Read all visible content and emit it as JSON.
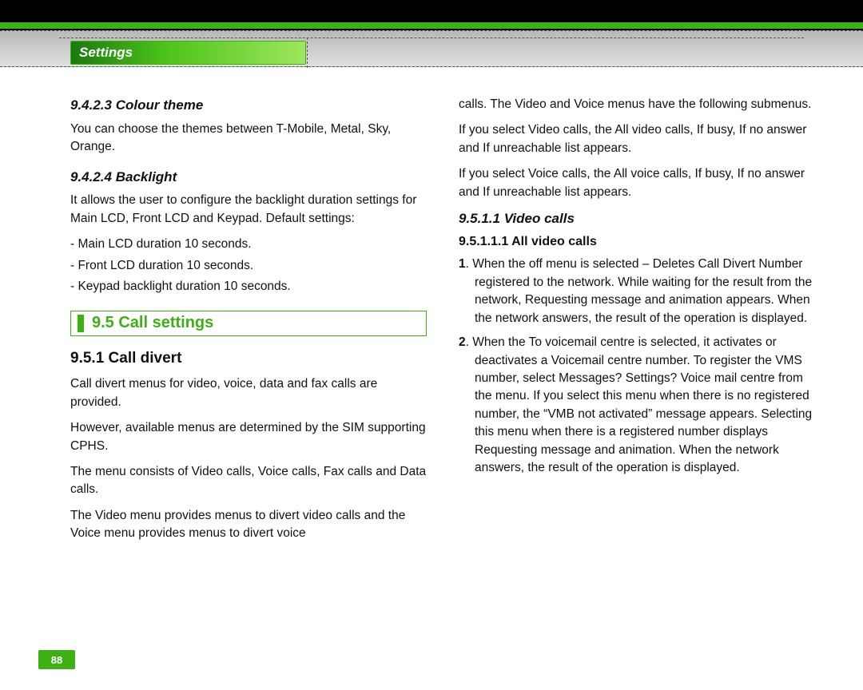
{
  "header": {
    "tab_label": "Settings"
  },
  "pagenum": "88",
  "left": {
    "s94_2_3_title": "9.4.2.3 Colour theme",
    "s94_2_3_body": "You can choose the themes between T-Mobile, Metal, Sky, Orange.",
    "s94_2_4_title": "9.4.2.4 Backlight",
    "s94_2_4_body": "It allows the user to configure the backlight duration settings for Main LCD, Front LCD and Keypad. Default settings:",
    "s94_2_4_li1": "- Main LCD duration 10 seconds.",
    "s94_2_4_li2": "- Front LCD duration 10 seconds.",
    "s94_2_4_li3": "- Keypad backlight duration 10 seconds.",
    "s95_title": "9.5 Call settings",
    "s951_title": "9.5.1 Call divert",
    "s951_p1": "Call divert menus for video, voice, data and fax calls are provided.",
    "s951_p2": "However, available menus are determined by the SIM supporting CPHS.",
    "s951_p3": "The menu consists of Video calls, Voice calls, Fax calls and Data calls.",
    "s951_p4": "The Video menu provides menus to divert video calls and the Voice menu provides menus to divert voice"
  },
  "right": {
    "cont1": "calls. The Video and Voice menus have the following submenus.",
    "cont2": "If you select Video calls, the All video calls, If busy, If no answer and If unreachable list appears.",
    "cont3": "If you select Voice calls, the All voice calls, If busy, If no answer  and If unreachable list appears.",
    "s9511_title": "9.5.1.1 Video calls",
    "s95111_title": "9.5.1.1.1 All video calls",
    "num1_prefix": "1",
    "num1_body": ". When the off menu is selected – Deletes Call Divert Number registered to the network. While waiting for the result from the network, Requesting message and animation appears. When the network answers, the result of the operation is displayed.",
    "num2_prefix": "2",
    "num2_body": ". When the To voicemail centre is selected, it activates or deactivates a Voicemail centre number. To register the VMS number, select Messages? Settings? Voice mail centre from the menu. If you select this menu when there is no registered number, the “VMB not activated” message appears. Selecting this menu when there is a registered number displays Requesting message and animation. When the network answers, the result of the operation is displayed."
  }
}
